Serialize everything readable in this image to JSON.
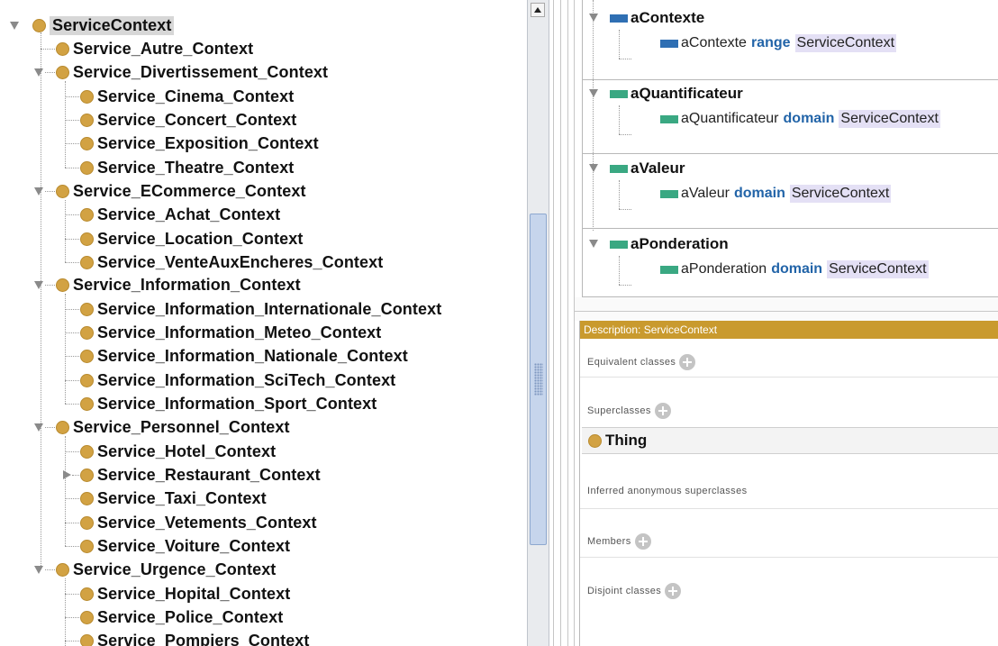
{
  "class_tree": {
    "root": "ServiceContext",
    "nodes": [
      "Service_Autre_Context",
      "Service_Divertissement_Context",
      "Service_Cinema_Context",
      "Service_Concert_Context",
      "Service_Exposition_Context",
      "Service_Theatre_Context",
      "Service_ECommerce_Context",
      "Service_Achat_Context",
      "Service_Location_Context",
      "Service_VenteAuxEncheres_Context",
      "Service_Information_Context",
      "Service_Information_Internationale_Context",
      "Service_Information_Meteo_Context",
      "Service_Information_Nationale_Context",
      "Service_Information_SciTech_Context",
      "Service_Information_Sport_Context",
      "Service_Personnel_Context",
      "Service_Hotel_Context",
      "Service_Restaurant_Context",
      "Service_Taxi_Context",
      "Service_Vetements_Context",
      "Service_Voiture_Context",
      "Service_Urgence_Context",
      "Service_Hopital_Context",
      "Service_Police_Context",
      "Service_Pompiers_Context"
    ]
  },
  "usage": {
    "groups": [
      {
        "property": "aContexte",
        "subject": "aContexte",
        "keyword": "range",
        "target": "ServiceContext",
        "color": "#2f6fb3"
      },
      {
        "property": "aQuantificateur",
        "subject": "aQuantificateur",
        "keyword": "domain",
        "target": "ServiceContext",
        "color": "#3aa882"
      },
      {
        "property": "aValeur",
        "subject": "aValeur",
        "keyword": "domain",
        "target": "ServiceContext",
        "color": "#3aa882"
      },
      {
        "property": "aPonderation",
        "subject": "aPonderation",
        "keyword": "domain",
        "target": "ServiceContext",
        "color": "#3aa882"
      }
    ]
  },
  "description": {
    "title": "Description: ServiceContext",
    "equivalent_classes": "Equivalent classes",
    "superclasses": "Superclasses",
    "superclass_item": "Thing",
    "inferred": "Inferred anonymous superclasses",
    "members": "Members",
    "disjoint": "Disjoint classes"
  },
  "colors": {
    "class_icon": "#d2a243",
    "header_bar": "#c99a2e",
    "keyword": "#2264a8",
    "highlight": "#e4e0f5"
  }
}
